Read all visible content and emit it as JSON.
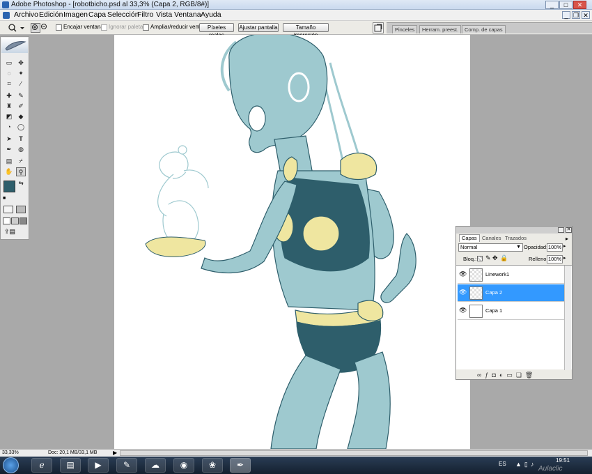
{
  "window": {
    "title": "Adobe Photoshop - [robotbicho.psd al 33,3% (Capa 2, RGB/8#)]",
    "minimize": "_",
    "maximize": "□",
    "close": "✕",
    "doc_minimize": "_",
    "doc_restore": "❐",
    "doc_close": "✕"
  },
  "menu": [
    "Archivo",
    "Edición",
    "Imagen",
    "Capa",
    "Selección",
    "Filtro",
    "Vista",
    "Ventana",
    "Ayuda"
  ],
  "options_bar": {
    "fit_window": "Encajar ventana",
    "ignore_palettes": "Ignorar paletas",
    "zoom_resize": "Ampliar/reducir vent.",
    "actual_pixels": "Píxeles reales",
    "fit_screen": "Ajustar pantalla",
    "print_size": "Tamaño impresión"
  },
  "palette_well_tabs": [
    "Pinceles",
    "Herram. preest.",
    "Comp. de capas"
  ],
  "layers_panel": {
    "tabs": [
      "Capas",
      "Canales",
      "Trazados"
    ],
    "blend_mode": "Normal",
    "opacity_label": "Opacidad:",
    "opacity_value": "100%",
    "lock_label": "Bloq.:",
    "fill_label": "Relleno:",
    "fill_value": "100%",
    "layers": [
      {
        "name": "Linework1",
        "selected": false
      },
      {
        "name": "Capa 2",
        "selected": true
      },
      {
        "name": "Capa 1",
        "selected": false
      }
    ],
    "selected_color": "#3399ff"
  },
  "status": {
    "zoom": "33,33%",
    "doc": "Doc: 20,1 MB/33,1 MB"
  },
  "taskbar": {
    "lang": "ES",
    "time": "19:51",
    "watermark": "Aulaclic"
  },
  "colors": {
    "fg": "#2e5e6b",
    "skin": "#9ec9cf",
    "top": "#2e5e6b",
    "accent": "#efe6a0"
  }
}
